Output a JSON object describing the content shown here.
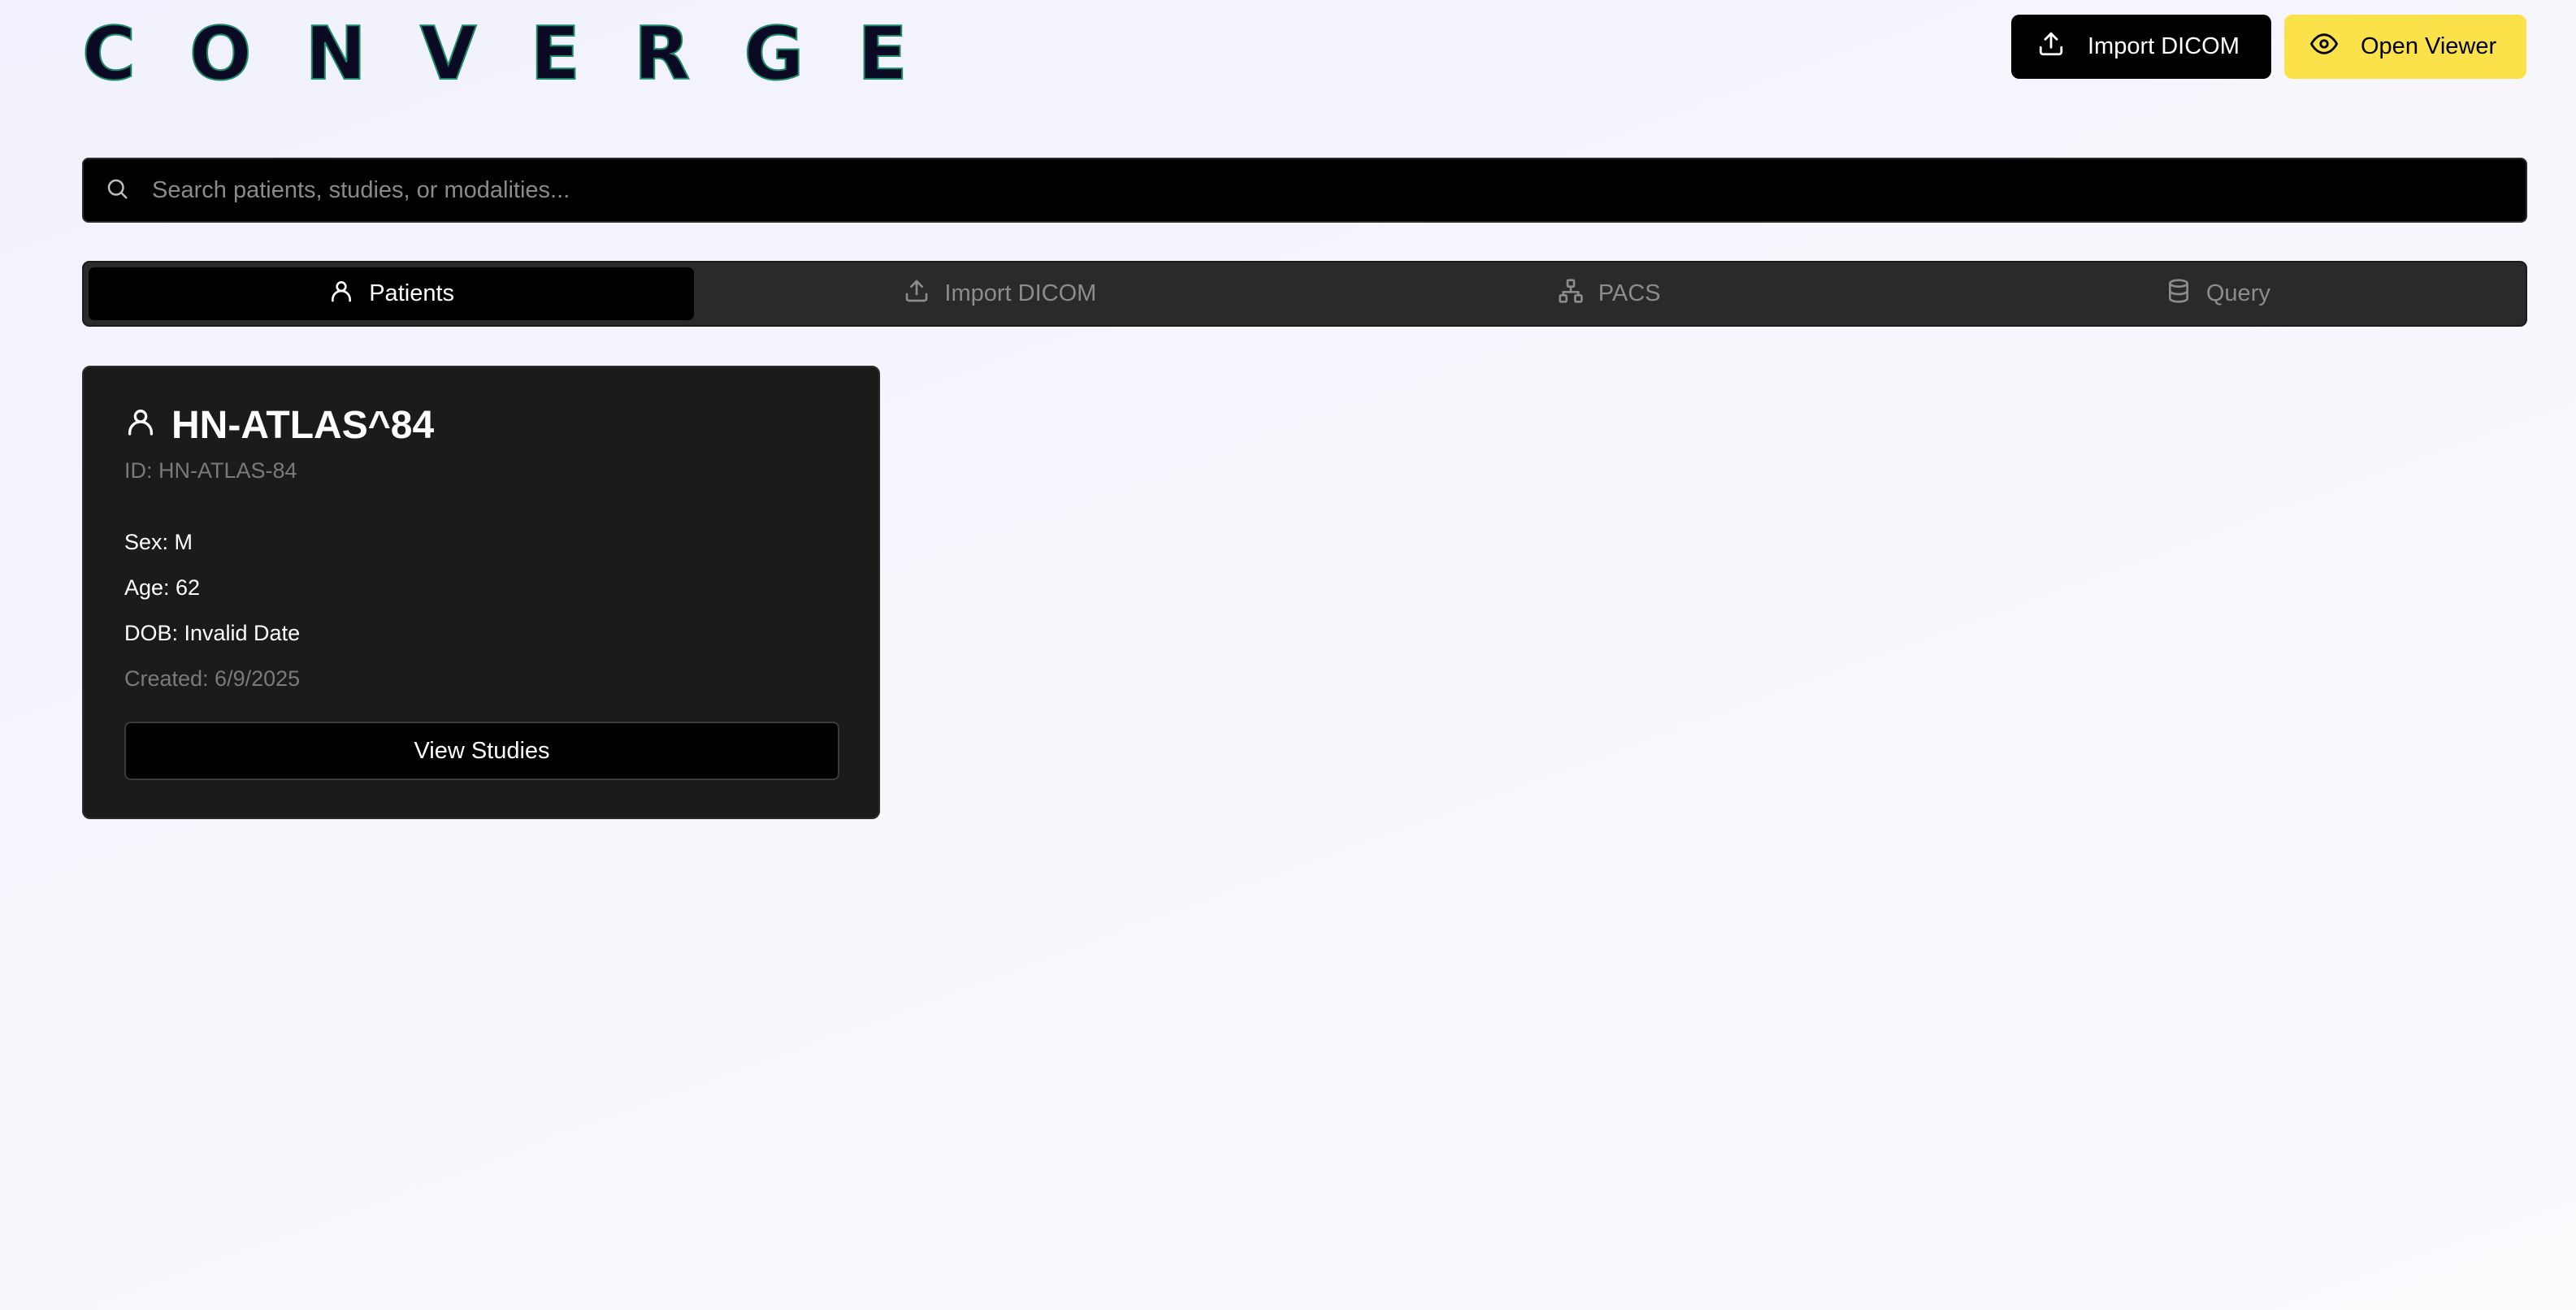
{
  "app": {
    "logo_text": "CONVERGE"
  },
  "header": {
    "import_label": "Import DICOM",
    "viewer_label": "Open Viewer"
  },
  "search": {
    "placeholder": "Search patients, studies, or modalities...",
    "value": ""
  },
  "tabs": [
    {
      "label": "Patients",
      "icon": "user-icon",
      "active": true
    },
    {
      "label": "Import DICOM",
      "icon": "upload-icon",
      "active": false
    },
    {
      "label": "PACS",
      "icon": "network-icon",
      "active": false
    },
    {
      "label": "Query",
      "icon": "database-icon",
      "active": false
    }
  ],
  "patient_card": {
    "name": "HN-ATLAS^84",
    "id_text": "ID: HN-ATLAS-84",
    "sex_text": "Sex: M",
    "age_text": "Age: 62",
    "dob_text": "DOB: Invalid Date",
    "created_text": "Created: 6/9/2025",
    "button_label": "View Studies"
  },
  "colors": {
    "accent_yellow": "#fbe14a",
    "logo_fill": "#0a0a24",
    "logo_outline": "#1c8c68",
    "card_bg": "#1b1b1b",
    "tabs_bg": "#2a2a2a"
  }
}
